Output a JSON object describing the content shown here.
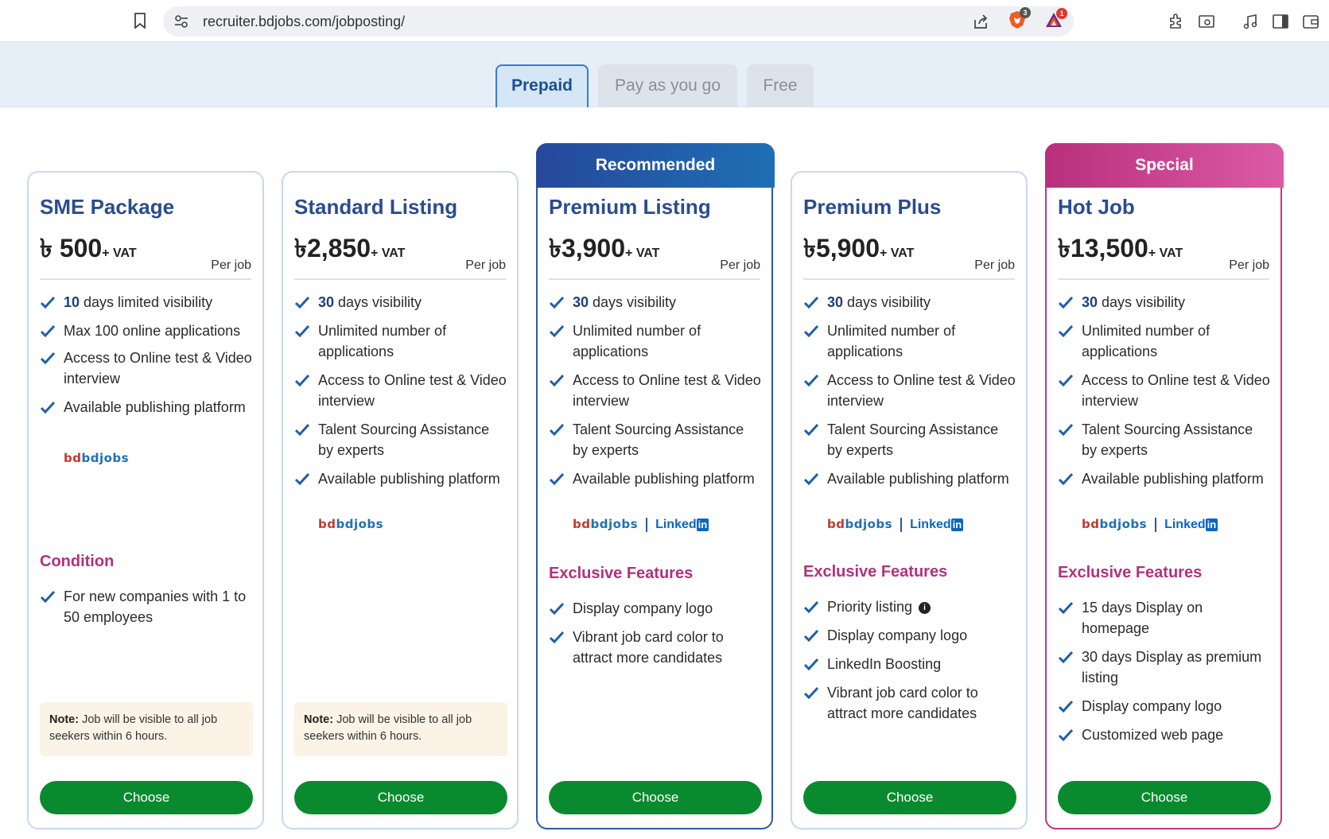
{
  "browser": {
    "url": "recruiter.bdjobs.com/jobposting/",
    "brave_badge": "3",
    "rewards_badge": "1"
  },
  "tabs": [
    {
      "label": "Prepaid",
      "active": true
    },
    {
      "label": "Pay as you go",
      "active": false
    },
    {
      "label": "Free",
      "active": false
    }
  ],
  "common": {
    "vat": "+ VAT",
    "per_job": "Per job",
    "choose": "Choose",
    "bdjobs_logo": "bdjobs",
    "linkedin_logo": "Linked",
    "linkedin_in": "in",
    "note_label": "Note:",
    "note_text": "Job will be visible to all job seekers within 6 hours."
  },
  "cards": [
    {
      "title": "SME Package",
      "price": "৳ 500",
      "features": [
        {
          "bold": "10",
          "text": " days limited visibility"
        },
        {
          "bold": "",
          "text": "Max 100 online applications"
        },
        {
          "bold": "",
          "text": "Access to Online test & Video interview"
        },
        {
          "bold": "",
          "text": "Available publishing platform"
        }
      ],
      "condition_heading": "Condition",
      "condition": "For new companies with 1 to 50 employees"
    },
    {
      "title": "Standard Listing",
      "price": "৳2,850",
      "features": [
        {
          "bold": "30",
          "text": " days visibility"
        },
        {
          "bold": "",
          "text": "Unlimited number of applications"
        },
        {
          "bold": "",
          "text": "Access to Online test & Video interview"
        },
        {
          "bold": "",
          "text": "Talent Sourcing Assistance by experts"
        },
        {
          "bold": "",
          "text": "Available publishing platform"
        }
      ]
    },
    {
      "ribbon": "Recommended",
      "title": "Premium Listing",
      "price": "৳3,900",
      "features": [
        {
          "bold": "30",
          "text": " days visibility"
        },
        {
          "bold": "",
          "text": "Unlimited number of applications"
        },
        {
          "bold": "",
          "text": "Access to Online test & Video interview"
        },
        {
          "bold": "",
          "text": "Talent Sourcing Assistance by experts"
        },
        {
          "bold": "",
          "text": "Available publishing platform"
        }
      ],
      "exclusive_heading": "Exclusive Features",
      "exclusive": [
        "Display company logo",
        "Vibrant job card color to attract more candidates"
      ]
    },
    {
      "title": "Premium Plus",
      "price": "৳5,900",
      "features": [
        {
          "bold": "30",
          "text": " days visibility"
        },
        {
          "bold": "",
          "text": "Unlimited number of applications"
        },
        {
          "bold": "",
          "text": "Access to Online test & Video interview"
        },
        {
          "bold": "",
          "text": "Talent Sourcing Assistance by experts"
        },
        {
          "bold": "",
          "text": "Available publishing platform"
        }
      ],
      "exclusive_heading": "Exclusive Features",
      "exclusive": [
        "Priority listing",
        "Display company logo",
        "LinkedIn Boosting",
        "Vibrant job card color to attract more candidates"
      ]
    },
    {
      "ribbon": "Special",
      "title": "Hot Job",
      "price": "৳13,500",
      "features": [
        {
          "bold": "30",
          "text": " days visibility"
        },
        {
          "bold": "",
          "text": "Unlimited number of applications"
        },
        {
          "bold": "",
          "text": "Access to Online test & Video interview"
        },
        {
          "bold": "",
          "text": "Talent Sourcing Assistance by experts"
        },
        {
          "bold": "",
          "text": "Available publishing platform"
        }
      ],
      "exclusive_heading": "Exclusive Features",
      "exclusive": [
        "15 days Display on homepage",
        "30 days Display as premium listing",
        "Display company logo",
        "Customized web page"
      ]
    }
  ]
}
